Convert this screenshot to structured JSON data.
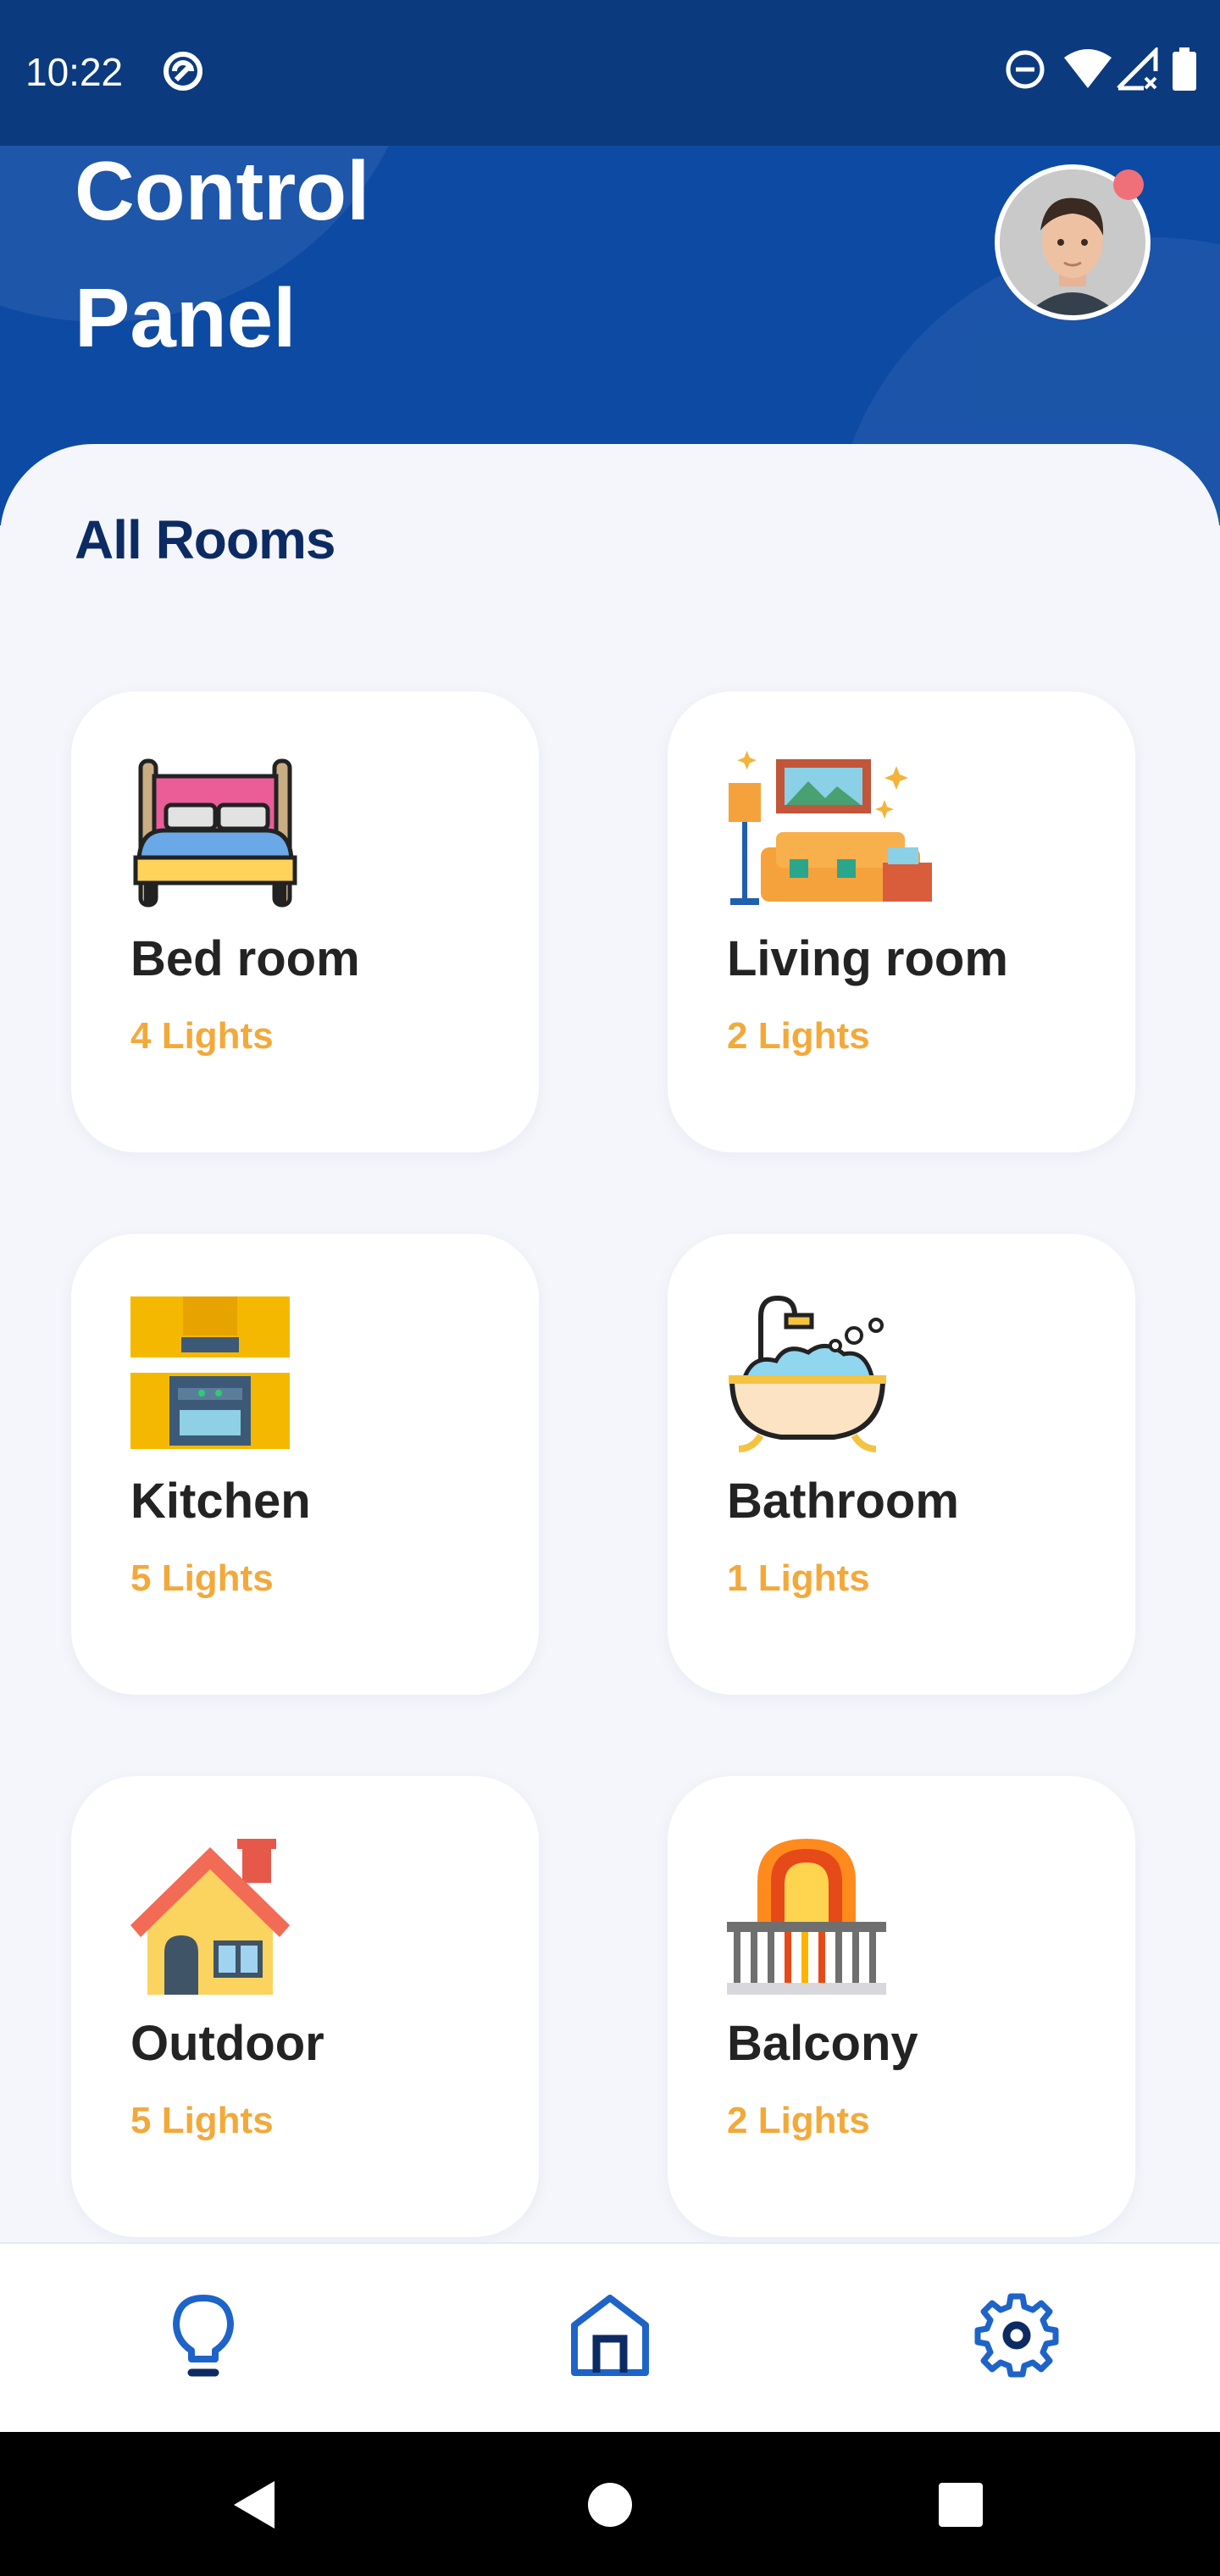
{
  "status_bar": {
    "time": "10:22",
    "icons": [
      "vpn-key-icon",
      "do-not-disturb-icon",
      "wifi-icon",
      "cell-signal-icon",
      "battery-icon"
    ]
  },
  "header": {
    "title": "Control Panel",
    "avatar_notification": true,
    "colors": {
      "primary": "#0d4aa3",
      "status_bar": "#0b3a7f",
      "notification_dot": "#f0707a"
    }
  },
  "section": {
    "title": "All Rooms"
  },
  "rooms": [
    {
      "name": "Bed room",
      "lights": "4 Lights",
      "icon": "bed-icon"
    },
    {
      "name": "Living room",
      "lights": "2 Lights",
      "icon": "living-room-icon"
    },
    {
      "name": "Kitchen",
      "lights": "5 Lights",
      "icon": "kitchen-icon"
    },
    {
      "name": "Bathroom",
      "lights": "1 Lights",
      "icon": "bathtub-icon"
    },
    {
      "name": "Outdoor",
      "lights": "5 Lights",
      "icon": "house-icon"
    },
    {
      "name": "Balcony",
      "lights": "2 Lights",
      "icon": "balcony-icon"
    }
  ],
  "bottom_nav": {
    "items": [
      {
        "icon": "lightbulb-icon"
      },
      {
        "icon": "home-icon",
        "active": true
      },
      {
        "icon": "settings-icon"
      }
    ],
    "accent": "#1e64c8"
  },
  "accent_colors": {
    "lights_text": "#f3a93a",
    "room_name": "#232323",
    "section_title": "#0d2b63"
  }
}
